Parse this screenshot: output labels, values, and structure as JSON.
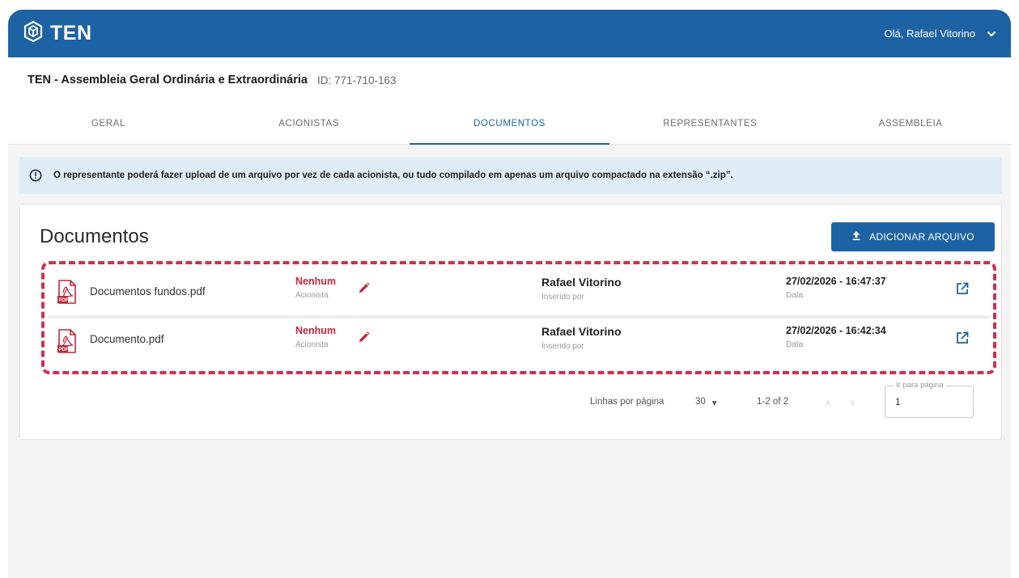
{
  "header": {
    "brand": "TEN",
    "greeting": "Olá, Rafael Vitorino"
  },
  "assembly": {
    "title": "TEN - Assembleia Geral Ordinária e Extraordinária",
    "id_label": "ID: 771-710-163"
  },
  "tabs": [
    {
      "label": "GERAL",
      "active": false
    },
    {
      "label": "ACIONISTAS",
      "active": false
    },
    {
      "label": "DOCUMENTOS",
      "active": true
    },
    {
      "label": "REPRESENTANTES",
      "active": false
    },
    {
      "label": "ASSEMBLEIA",
      "active": false
    }
  ],
  "alert": {
    "message": "O representante poderá fazer upload de um arquivo por vez de cada acionista, ou tudo compilado em apenas um arquivo compactado na extensão “.zip”."
  },
  "documents": {
    "title": "Documentos",
    "add_button": "ADICIONAR ARQUIVO",
    "rows": [
      {
        "file_name": "Documentos fundos.pdf",
        "acionista_value": "Nenhum",
        "acionista_label": "Acionista",
        "inserted_by": "Rafael Vitorino",
        "inserted_by_label": "Inserido por",
        "date": "27/02/2026 - 16:47:37",
        "date_label": "Data"
      },
      {
        "file_name": "Documento.pdf",
        "acionista_value": "Nenhum",
        "acionista_label": "Acionista",
        "inserted_by": "Rafael Vitorino",
        "inserted_by_label": "Inserido por",
        "date": "27/02/2026 - 16:42:34",
        "date_label": "Data"
      }
    ]
  },
  "pagination": {
    "rows_per_page_label": "Linhas por página",
    "rows_per_page_value": "30",
    "range": "1-2 of 2",
    "goto_label": "Ir para página",
    "goto_value": "1"
  },
  "colors": {
    "primary": "#1d63a3",
    "alert_bg": "#dfecf6",
    "highlight_border": "#cf2f4d",
    "acionista_red": "#c0283b"
  }
}
